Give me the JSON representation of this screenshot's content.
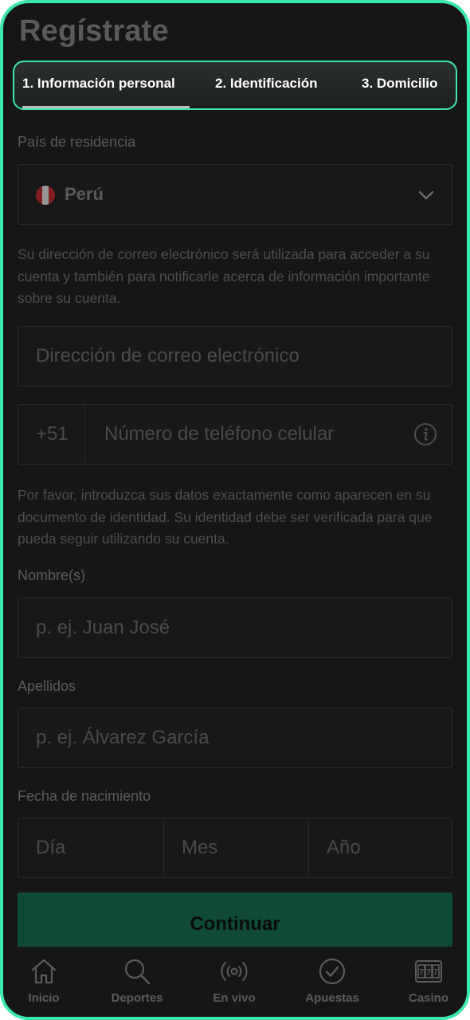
{
  "page": {
    "title": "Regístrate"
  },
  "steps": [
    {
      "label": "1.  Información personal",
      "active": true
    },
    {
      "label": "2.  Identificación",
      "active": false
    },
    {
      "label": "3.  Domicilio",
      "active": false
    }
  ],
  "country": {
    "label": "País de residencia",
    "value": "Perú",
    "flag_icon": "peru-flag-icon",
    "dropdown_icon": "chevron-down-icon"
  },
  "email_notice": "Su dirección de correo electrónico será utilizada para acceder a su cuenta y también para notificarle acerca de información importante sobre su cuenta.",
  "email": {
    "placeholder": "Dirección de correo electrónico",
    "value": ""
  },
  "phone": {
    "prefix": "+51",
    "placeholder": "Número de teléfono celular",
    "value": "",
    "info_icon": "info-icon"
  },
  "identity_notice": "Por favor, introduzca sus datos exactamente como aparecen en su documento de identidad. Su identidad debe ser verificada para que pueda seguir utilizando su cuenta.",
  "first_name": {
    "label": "Nombre(s)",
    "placeholder": "p. ej. Juan José",
    "value": ""
  },
  "last_name": {
    "label": "Apellidos",
    "placeholder": "p. ej. Álvarez García",
    "value": ""
  },
  "birthdate": {
    "label": "Fecha de nacimiento",
    "day_placeholder": "Día",
    "month_placeholder": "Mes",
    "year_placeholder": "Año"
  },
  "continue_label": "Continuar",
  "nav": [
    {
      "label": "Inicio",
      "icon": "home-icon"
    },
    {
      "label": "Deportes",
      "icon": "search-icon"
    },
    {
      "label": "En vivo",
      "icon": "live-broadcast-icon"
    },
    {
      "label": "Apuestas",
      "icon": "check-circle-icon"
    },
    {
      "label": "Casino",
      "icon": "slot-machine-icon"
    }
  ],
  "colors": {
    "accent": "#3ee6b0",
    "background": "#161616",
    "button": "#0e4a34",
    "field_border": "#2c2c2c",
    "muted_text": "#5b5b5b"
  }
}
